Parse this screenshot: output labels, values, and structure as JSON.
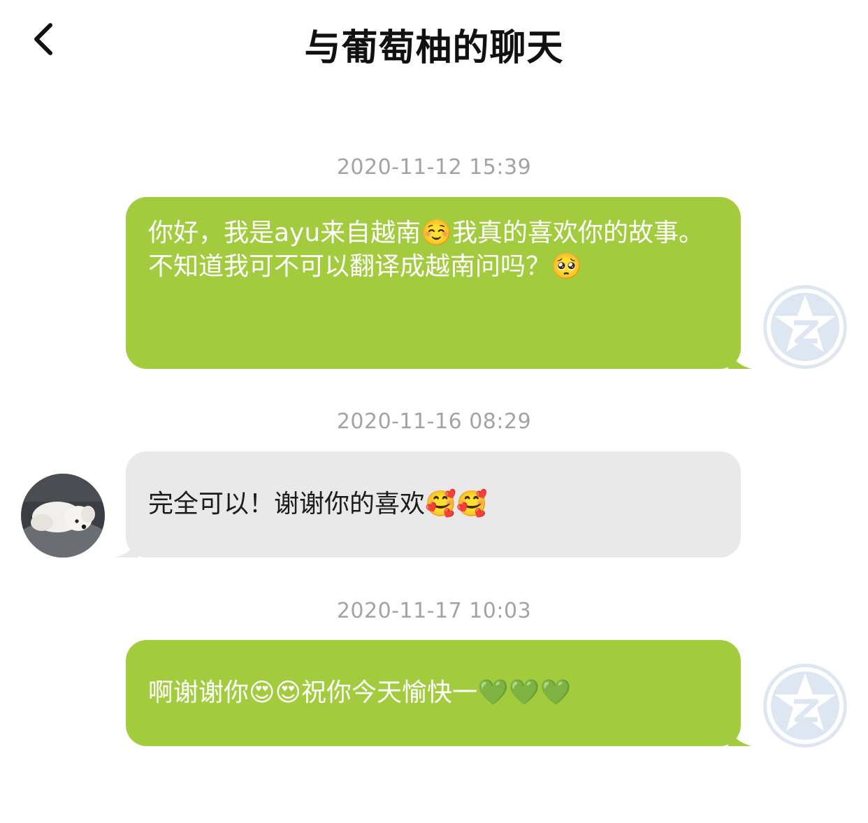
{
  "header": {
    "title": "与葡萄柚的聊天",
    "back_icon": "chevron-left-icon"
  },
  "messages": [
    {
      "timestamp": "2020-11-12 15:39",
      "direction": "sent",
      "text": "你好，我是ayu来自越南☺️我真的喜欢你的故事。不知道我可不可以翻译成越南问吗？🥺",
      "avatar": "default-star-avatar-icon"
    },
    {
      "timestamp": "2020-11-16 08:29",
      "direction": "received",
      "text": "完全可以！谢谢你的喜欢🥰🥰",
      "avatar": "dog-photo-avatar"
    },
    {
      "timestamp": "2020-11-17 10:03",
      "direction": "sent",
      "text": "啊谢谢你😍😍祝你今天愉快一💚💚💚",
      "avatar": "default-star-avatar-icon"
    }
  ],
  "colors": {
    "sent_bubble": "#a3cb3e",
    "received_bubble": "#e9e9e9",
    "timestamp": "#a3a3a3",
    "default_avatar": "#dde6f1"
  }
}
